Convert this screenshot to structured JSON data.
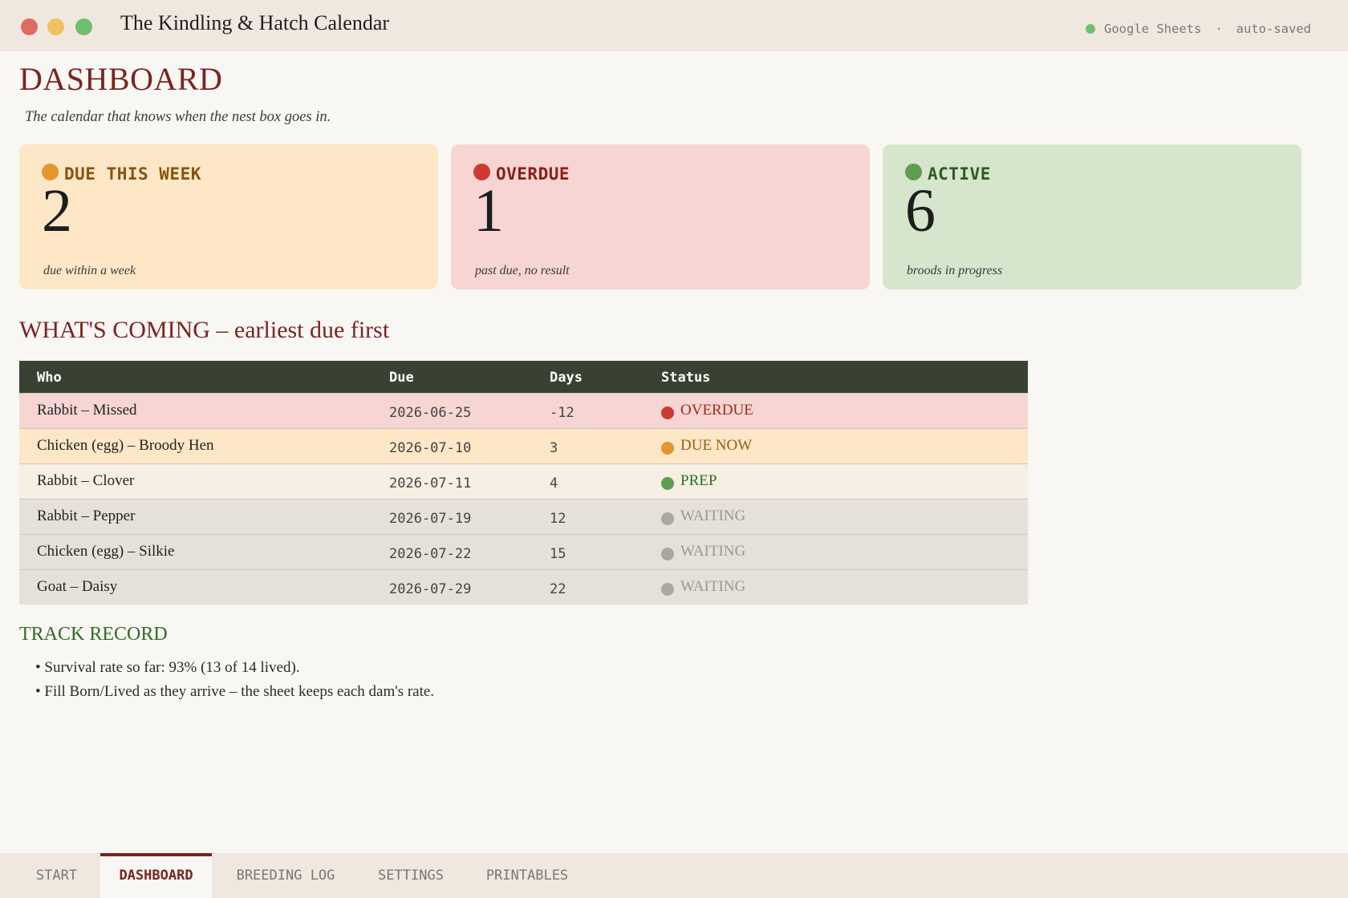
{
  "window": {
    "title": "The Kindling & Hatch Calendar",
    "sync_app": "Google Sheets",
    "separator": "·",
    "sync_status": "auto-saved"
  },
  "page": {
    "title": "DASHBOARD",
    "tagline": "The calendar that knows when the nest box goes in."
  },
  "cards": {
    "due": {
      "label": "DUE THIS WEEK",
      "value": "2",
      "sub": "due within a week",
      "color": "#e3962c"
    },
    "overdue": {
      "label": "OVERDUE",
      "value": "1",
      "sub": "past due, no result",
      "color": "#cc3a32"
    },
    "active": {
      "label": "ACTIVE",
      "value": "6",
      "sub": "broods in progress",
      "color": "#5f9e4e"
    }
  },
  "coming": {
    "title": "WHAT'S COMING – earliest due first",
    "headers": {
      "who": "Who",
      "due": "Due",
      "days": "Days",
      "status": "Status"
    },
    "rows": [
      {
        "who": "Rabbit – Missed",
        "due": "2026-06-25",
        "days": "-12",
        "status": "OVERDUE"
      },
      {
        "who": "Chicken (egg) – Broody Hen",
        "due": "2026-07-10",
        "days": "3",
        "status": "DUE NOW"
      },
      {
        "who": "Rabbit – Clover",
        "due": "2026-07-11",
        "days": "4",
        "status": "PREP"
      },
      {
        "who": "Rabbit – Pepper",
        "due": "2026-07-19",
        "days": "12",
        "status": "WAITING"
      },
      {
        "who": "Chicken (egg) – Silkie",
        "due": "2026-07-22",
        "days": "15",
        "status": "WAITING"
      },
      {
        "who": "Goat – Daisy",
        "due": "2026-07-29",
        "days": "22",
        "status": "WAITING"
      }
    ]
  },
  "track": {
    "title": "TRACK RECORD",
    "bullets": [
      "• Survival rate so far: 93% (13 of 14 lived).",
      "• Fill Born/Lived as they arrive – the sheet keeps each dam's rate."
    ]
  },
  "tabs": [
    "START",
    "DASHBOARD",
    "BREEDING LOG",
    "SETTINGS",
    "PRINTABLES"
  ]
}
